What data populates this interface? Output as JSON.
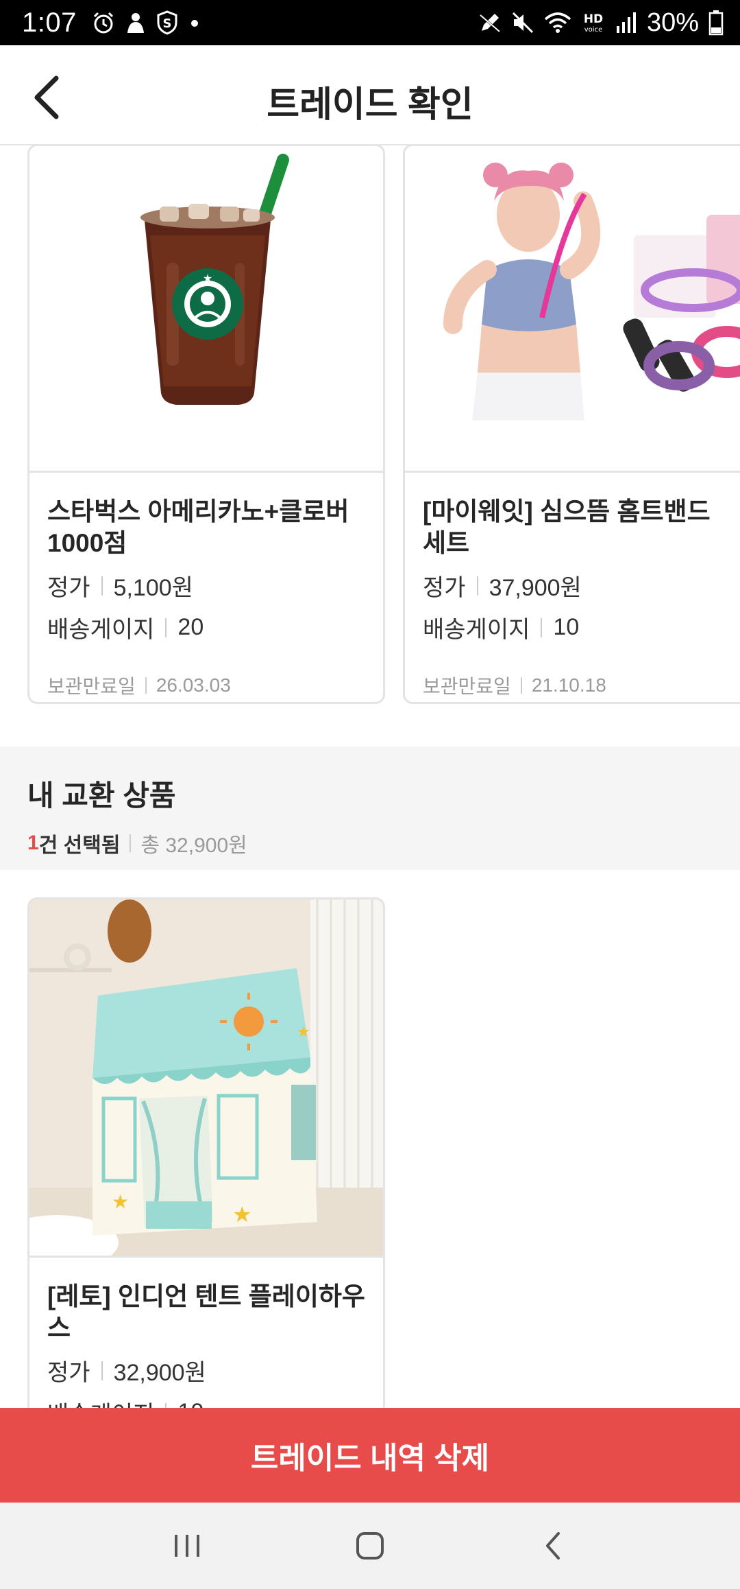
{
  "status_bar": {
    "time": "1:07",
    "battery": "30%",
    "left_icons": [
      "alarm-icon",
      "person-notification-icon",
      "shield-s-icon",
      "dot-icon"
    ],
    "right_icons": [
      "pen-icon",
      "mute-icon",
      "wifi-icon",
      "hd-voice-icon",
      "signal-icon",
      "battery-icon"
    ]
  },
  "header": {
    "title": "트레이드 확인",
    "back_icon": "chevron-left-icon"
  },
  "offer_items": [
    {
      "name": "스타벅스 아메리카노+클로버 1000점",
      "price_label": "정가",
      "price": "5,100원",
      "gauge_label": "배송게이지",
      "gauge": "20",
      "expiry_label": "보관만료일",
      "expiry": "26.03.03",
      "image": "starbucks-iced-coffee-image"
    },
    {
      "name": "[마이웨잇] 심으뜸 홈트밴드 세트",
      "price_label": "정가",
      "price": "37,900원",
      "gauge_label": "배송게이지",
      "gauge": "10",
      "expiry_label": "보관만료일",
      "expiry": "21.10.18",
      "image": "fitness-band-set-image"
    }
  ],
  "my_section": {
    "title": "내 교환 상품",
    "count": "1",
    "selected_label": "건 선택됨",
    "total": "총 32,900원"
  },
  "my_items": [
    {
      "name": "[레토] 인디언 텐트 플레이하우스",
      "price_label": "정가",
      "price": "32,900원",
      "gauge_label": "배송게이지",
      "gauge": "10",
      "image": "kids-tent-playhouse-image"
    }
  ],
  "delete_button": "트레이드 내역 삭제",
  "nav": {
    "recents_icon": "recents-icon",
    "home_icon": "home-icon",
    "back_icon": "back-icon"
  },
  "colors": {
    "accent": "#e84c4a",
    "section_bg": "#f5f5f5",
    "border": "#e3e3e3"
  }
}
